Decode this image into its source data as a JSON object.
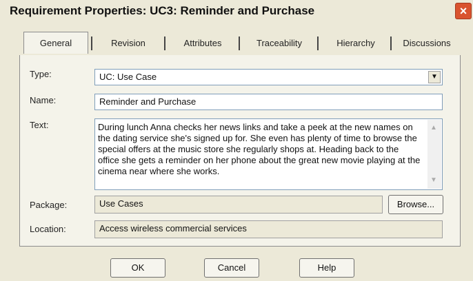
{
  "dialog": {
    "title": "Requirement Properties: UC3: Reminder and Purchase",
    "close_label": "×"
  },
  "tabs": [
    {
      "label": "General",
      "active": true
    },
    {
      "label": "Revision",
      "active": false
    },
    {
      "label": "Attributes",
      "active": false
    },
    {
      "label": "Traceability",
      "active": false
    },
    {
      "label": "Hierarchy",
      "active": false
    },
    {
      "label": "Discussions",
      "active": false
    }
  ],
  "form": {
    "type_label": "Type:",
    "type_value": "UC: Use Case",
    "name_label": "Name:",
    "name_value": "Reminder and Purchase",
    "text_label": "Text:",
    "text_value": "During lunch Anna checks her news links and take a peek at the new names on the dating service she's signed up for. She even has plenty of time to browse the special offers at the music store she regularly shops at. Heading back to the office she gets a reminder on her phone about the great new movie playing at the cinema near where she works.",
    "package_label": "Package:",
    "package_value": "Use Cases",
    "browse_label": "Browse...",
    "location_label": "Location:",
    "location_value": "Access wireless commercial services"
  },
  "buttons": {
    "ok": "OK",
    "cancel": "Cancel",
    "help": "Help"
  },
  "icons": {
    "combo_arrow": "▼",
    "scroll_up": "▲",
    "scroll_down": "▼"
  }
}
